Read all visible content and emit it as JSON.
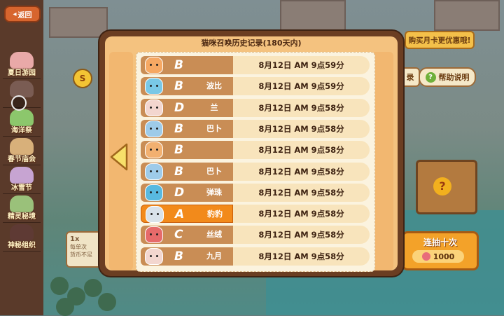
{
  "back_button": {
    "label": "返回"
  },
  "side_menu": {
    "items": [
      {
        "label": "夏日游园",
        "color": "#e9a9a8"
      },
      {
        "label": "",
        "color": "#7a5c53"
      },
      {
        "label": "海洋祭",
        "color": "#8cc76c"
      },
      {
        "label": "春节庙会",
        "color": "#d8b07a"
      },
      {
        "label": "冰雪节",
        "color": "#c7a4d2"
      },
      {
        "label": "精灵秘境",
        "color": "#9ac17a"
      },
      {
        "label": "神秘组织",
        "color": "#5e3a34"
      }
    ]
  },
  "background_panel": {
    "promo_text": "购买月卡更优惠哦!",
    "help_label": "帮助说明",
    "record_peek": "录",
    "ten_draw_label": "连抽十次",
    "ten_draw_cost": "1000",
    "single_count": "1x",
    "single_note_1": "每单次",
    "single_note_2": "货币不足"
  },
  "dialog": {
    "title": "猫咪召唤历史记录(180天内)",
    "rows": [
      {
        "grade": "B",
        "name": "",
        "time": "8月12日 AM 9点59分",
        "avatar_color": "#f6a863",
        "highlight": false
      },
      {
        "grade": "B",
        "name": "波比",
        "time": "8月12日 AM 9点59分",
        "avatar_color": "#79c8e6",
        "highlight": false
      },
      {
        "grade": "D",
        "name": "兰",
        "time": "8月12日 AM 9点58分",
        "avatar_color": "#f3d6cf",
        "highlight": false
      },
      {
        "grade": "B",
        "name": "巴卜",
        "time": "8月12日 AM 9点58分",
        "avatar_color": "#9ecbe9",
        "highlight": false
      },
      {
        "grade": "B",
        "name": "",
        "time": "8月12日 AM 9点58分",
        "avatar_color": "#f2b070",
        "highlight": false
      },
      {
        "grade": "B",
        "name": "巴卜",
        "time": "8月12日 AM 9点58分",
        "avatar_color": "#9ecbe9",
        "highlight": false
      },
      {
        "grade": "D",
        "name": "弹珠",
        "time": "8月12日 AM 9点58分",
        "avatar_color": "#58b9e0",
        "highlight": false
      },
      {
        "grade": "A",
        "name": "豹豹",
        "time": "8月12日 AM 9点58分",
        "avatar_color": "#d9e2ea",
        "highlight": true
      },
      {
        "grade": "C",
        "name": "丝绒",
        "time": "8月12日 AM 9点58分",
        "avatar_color": "#e66a6a",
        "highlight": false
      },
      {
        "grade": "B",
        "name": "九月",
        "time": "8月12日 AM 9点58分",
        "avatar_color": "#f3d6cf",
        "highlight": false
      }
    ]
  }
}
